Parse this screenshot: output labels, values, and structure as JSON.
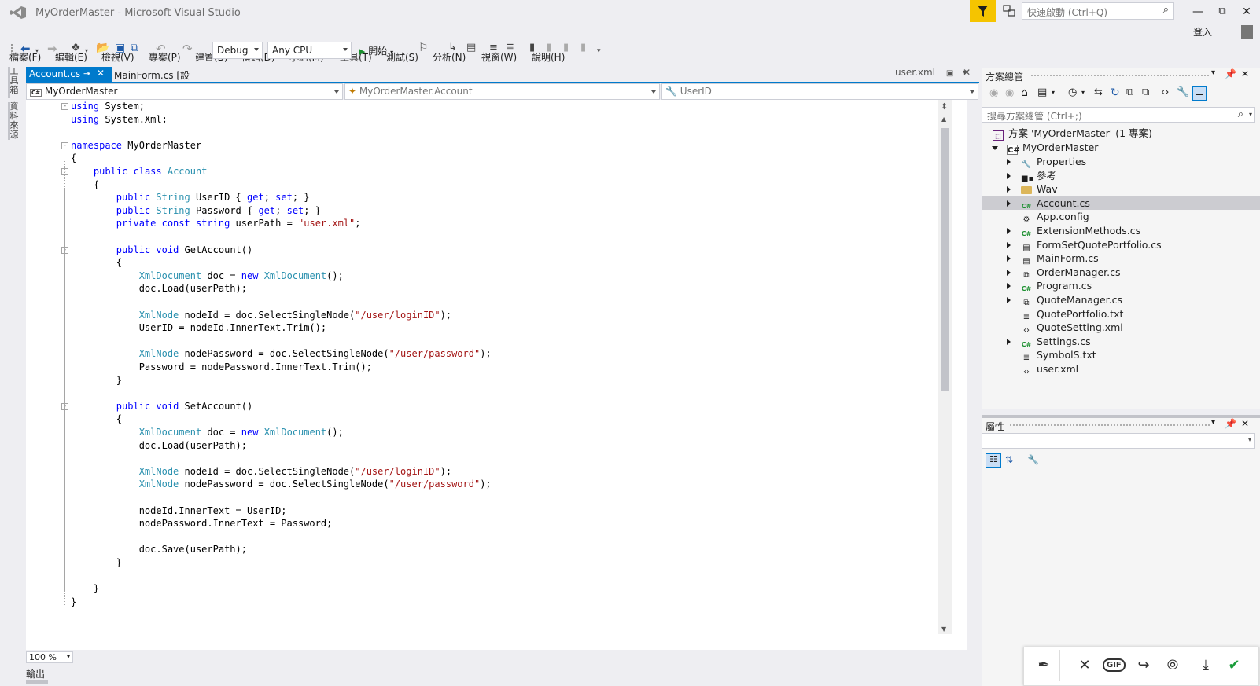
{
  "window": {
    "title": "MyOrderMaster - Microsoft Visual Studio",
    "quick_launch_placeholder": "快速啟動 (Ctrl+Q)",
    "login": "登入"
  },
  "menu": [
    "檔案(F)",
    "編輯(E)",
    "檢視(V)",
    "專案(P)",
    "建置(B)",
    "偵錯(D)",
    "小組(M)",
    "工具(T)",
    "測試(S)",
    "分析(N)",
    "視窗(W)",
    "說明(H)"
  ],
  "toolbar": {
    "config": "Debug",
    "platform": "Any CPU",
    "start": "開始"
  },
  "left_rail": {
    "toolbox": "工具箱",
    "datasource": "資料來源"
  },
  "tabs": {
    "active": "Account.cs",
    "second": "MainForm.cs [設計]",
    "preview": "user.xml"
  },
  "navbar": {
    "project": "MyOrderMaster",
    "type": "MyOrderMaster.Account",
    "member": "UserID"
  },
  "code": [
    [
      [
        "kw",
        "using"
      ],
      [
        "tx",
        " System;"
      ]
    ],
    [
      [
        "kw",
        "using"
      ],
      [
        "tx",
        " System.Xml;"
      ]
    ],
    [],
    [
      [
        "kw",
        "namespace"
      ],
      [
        "tx",
        " MyOrderMaster"
      ]
    ],
    [
      [
        "tx",
        "{"
      ]
    ],
    [
      [
        "tx",
        "    "
      ],
      [
        "kw",
        "public"
      ],
      [
        "tx",
        " "
      ],
      [
        "kw",
        "class"
      ],
      [
        "tx",
        " "
      ],
      [
        "ty",
        "Account"
      ]
    ],
    [
      [
        "tx",
        "    {"
      ]
    ],
    [
      [
        "tx",
        "        "
      ],
      [
        "kw",
        "public"
      ],
      [
        "tx",
        " "
      ],
      [
        "ty",
        "String"
      ],
      [
        "tx",
        " UserID { "
      ],
      [
        "kw",
        "get"
      ],
      [
        "tx",
        "; "
      ],
      [
        "kw",
        "set"
      ],
      [
        "tx",
        "; }"
      ]
    ],
    [
      [
        "tx",
        "        "
      ],
      [
        "kw",
        "public"
      ],
      [
        "tx",
        " "
      ],
      [
        "ty",
        "String"
      ],
      [
        "tx",
        " Password { "
      ],
      [
        "kw",
        "get"
      ],
      [
        "tx",
        "; "
      ],
      [
        "kw",
        "set"
      ],
      [
        "tx",
        "; }"
      ]
    ],
    [
      [
        "tx",
        "        "
      ],
      [
        "kw",
        "private"
      ],
      [
        "tx",
        " "
      ],
      [
        "kw",
        "const"
      ],
      [
        "tx",
        " "
      ],
      [
        "kw",
        "string"
      ],
      [
        "tx",
        " userPath = "
      ],
      [
        "st",
        "\"user.xml\""
      ],
      [
        "tx",
        ";"
      ]
    ],
    [],
    [
      [
        "tx",
        "        "
      ],
      [
        "kw",
        "public"
      ],
      [
        "tx",
        " "
      ],
      [
        "kw",
        "void"
      ],
      [
        "tx",
        " GetAccount()"
      ]
    ],
    [
      [
        "tx",
        "        {"
      ]
    ],
    [
      [
        "tx",
        "            "
      ],
      [
        "ty",
        "XmlDocument"
      ],
      [
        "tx",
        " doc = "
      ],
      [
        "kw",
        "new"
      ],
      [
        "tx",
        " "
      ],
      [
        "ty",
        "XmlDocument"
      ],
      [
        "tx",
        "();"
      ]
    ],
    [
      [
        "tx",
        "            doc.Load(userPath);"
      ]
    ],
    [],
    [
      [
        "tx",
        "            "
      ],
      [
        "ty",
        "XmlNode"
      ],
      [
        "tx",
        " nodeId = doc.SelectSingleNode("
      ],
      [
        "st",
        "\"/user/loginID\""
      ],
      [
        "tx",
        ");"
      ]
    ],
    [
      [
        "tx",
        "            UserID = nodeId.InnerText.Trim();"
      ]
    ],
    [],
    [
      [
        "tx",
        "            "
      ],
      [
        "ty",
        "XmlNode"
      ],
      [
        "tx",
        " nodePassword = doc.SelectSingleNode("
      ],
      [
        "st",
        "\"/user/password\""
      ],
      [
        "tx",
        ");"
      ]
    ],
    [
      [
        "tx",
        "            Password = nodePassword.InnerText.Trim();"
      ]
    ],
    [
      [
        "tx",
        "        }"
      ]
    ],
    [],
    [
      [
        "tx",
        "        "
      ],
      [
        "kw",
        "public"
      ],
      [
        "tx",
        " "
      ],
      [
        "kw",
        "void"
      ],
      [
        "tx",
        " SetAccount()"
      ]
    ],
    [
      [
        "tx",
        "        {"
      ]
    ],
    [
      [
        "tx",
        "            "
      ],
      [
        "ty",
        "XmlDocument"
      ],
      [
        "tx",
        " doc = "
      ],
      [
        "kw",
        "new"
      ],
      [
        "tx",
        " "
      ],
      [
        "ty",
        "XmlDocument"
      ],
      [
        "tx",
        "();"
      ]
    ],
    [
      [
        "tx",
        "            doc.Load(userPath);"
      ]
    ],
    [],
    [
      [
        "tx",
        "            "
      ],
      [
        "ty",
        "XmlNode"
      ],
      [
        "tx",
        " nodeId = doc.SelectSingleNode("
      ],
      [
        "st",
        "\"/user/loginID\""
      ],
      [
        "tx",
        ");"
      ]
    ],
    [
      [
        "tx",
        "            "
      ],
      [
        "ty",
        "XmlNode"
      ],
      [
        "tx",
        " nodePassword = doc.SelectSingleNode("
      ],
      [
        "st",
        "\"/user/password\""
      ],
      [
        "tx",
        ");"
      ]
    ],
    [],
    [
      [
        "tx",
        "            nodeId.InnerText = UserID;"
      ]
    ],
    [
      [
        "tx",
        "            nodePassword.InnerText = Password;"
      ]
    ],
    [],
    [
      [
        "tx",
        "            doc.Save(userPath);"
      ]
    ],
    [
      [
        "tx",
        "        }"
      ]
    ],
    [],
    [
      [
        "tx",
        "    }"
      ]
    ],
    [
      [
        "tx",
        "}"
      ]
    ]
  ],
  "zoom": "100 %",
  "output_label": "輸出",
  "solution_explorer": {
    "title": "方案總管",
    "search_placeholder": "搜尋方案總管 (Ctrl+;)",
    "solution": "方案 'MyOrderMaster' (1 專案)",
    "project": "MyOrderMaster",
    "items": [
      {
        "label": "Properties",
        "icon": "wrench-icon",
        "expandable": true
      },
      {
        "label": "參考",
        "icon": "references-icon",
        "expandable": true
      },
      {
        "label": "Wav",
        "icon": "folder-icon",
        "expandable": true
      },
      {
        "label": "Account.cs",
        "icon": "csharp-file-icon",
        "expandable": true,
        "selected": true
      },
      {
        "label": "App.config",
        "icon": "config-file-icon",
        "expandable": false
      },
      {
        "label": "ExtensionMethods.cs",
        "icon": "csharp-file-icon",
        "expandable": true
      },
      {
        "label": "FormSetQuotePortfolio.cs",
        "icon": "form-icon",
        "expandable": true
      },
      {
        "label": "MainForm.cs",
        "icon": "form-icon",
        "expandable": true
      },
      {
        "label": "OrderManager.cs",
        "icon": "component-icon",
        "expandable": true
      },
      {
        "label": "Program.cs",
        "icon": "csharp-file-icon",
        "expandable": true
      },
      {
        "label": "QuoteManager.cs",
        "icon": "component-icon",
        "expandable": true
      },
      {
        "label": "QuotePortfolio.txt",
        "icon": "text-file-icon",
        "expandable": false
      },
      {
        "label": "QuoteSetting.xml",
        "icon": "xml-file-icon",
        "expandable": false
      },
      {
        "label": "Settings.cs",
        "icon": "csharp-file-icon",
        "expandable": true
      },
      {
        "label": "SymbolS.txt",
        "icon": "text-file-icon",
        "expandable": false
      },
      {
        "label": "user.xml",
        "icon": "xml-file-icon",
        "expandable": false
      }
    ]
  },
  "properties": {
    "title": "屬性"
  },
  "colors": {
    "accent": "#007acc",
    "filter": "#f5c400",
    "keyword": "#0000ff",
    "type": "#2b91af",
    "string": "#a31515",
    "selection": "#ccccd1"
  }
}
